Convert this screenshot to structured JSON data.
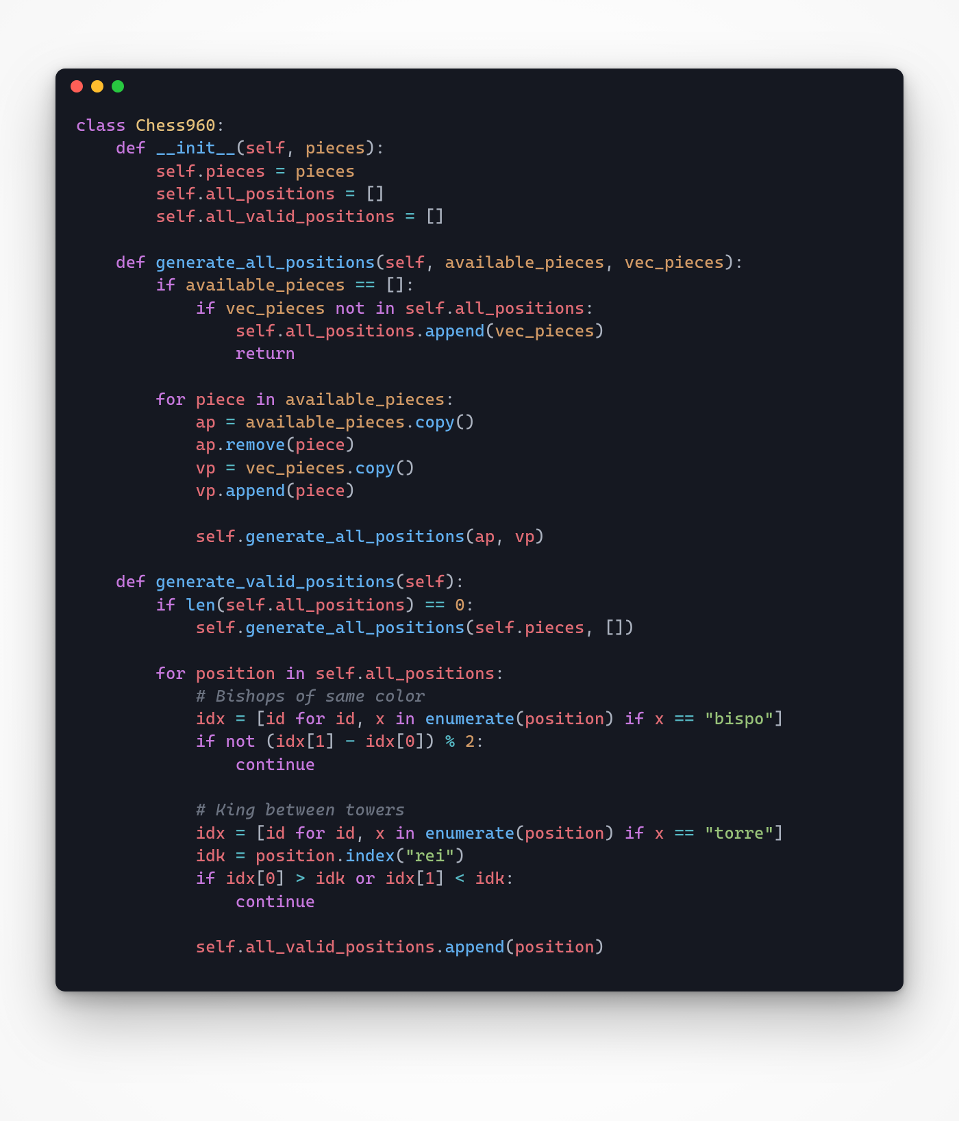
{
  "window": {
    "traffic_lights": [
      "close",
      "minimize",
      "zoom"
    ]
  },
  "code": {
    "language": "python",
    "class_name": "Chess960",
    "methods": {
      "init": {
        "name": "__init__",
        "params": [
          "self",
          "pieces"
        ],
        "body": [
          "self.pieces = pieces",
          "self.all_positions = []",
          "self.all_valid_positions = []"
        ]
      },
      "generate_all_positions": {
        "name": "generate_all_positions",
        "params": [
          "self",
          "available_pieces",
          "vec_pieces"
        ],
        "body": [
          "if available_pieces == []:",
          "    if vec_pieces not in self.all_positions:",
          "        self.all_positions.append(vec_pieces)",
          "        return",
          "",
          "for piece in available_pieces:",
          "    ap = available_pieces.copy()",
          "    ap.remove(piece)",
          "    vp = vec_pieces.copy()",
          "    vp.append(piece)",
          "",
          "    self.generate_all_positions(ap, vp)"
        ]
      },
      "generate_valid_positions": {
        "name": "generate_valid_positions",
        "params": [
          "self"
        ],
        "body": [
          "if len(self.all_positions) == 0:",
          "    self.generate_all_positions(self.pieces, [])",
          "",
          "for position in self.all_positions:",
          "    # Bishops of same color",
          "    idx = [id for id, x in enumerate(position) if x == \"bispo\"]",
          "    if not (idx[1] - idx[0]) % 2:",
          "        continue",
          "",
          "    # King between towers",
          "    idx = [id for id, x in enumerate(position) if x == \"torre\"]",
          "    idk = position.index(\"rei\")",
          "    if idx[0] > idk or idx[1] < idk:",
          "        continue",
          "",
          "    self.all_valid_positions.append(position)"
        ]
      }
    },
    "strings": {
      "bispo": "bispo",
      "torre": "torre",
      "rei": "rei"
    },
    "comments": {
      "bishops": "# Bishops of same color",
      "king": "# King between towers"
    },
    "tokens": {
      "class": "class",
      "def": "def",
      "if": "if",
      "for": "for",
      "in": "in",
      "not": "not",
      "or": "or",
      "return": "return",
      "continue": "continue",
      "self": "self",
      "len": "len",
      "enumerate": "enumerate",
      "append": "append",
      "remove": "remove",
      "copy": "copy",
      "index": "index",
      "pieces_attr": "pieces",
      "all_positions_attr": "all_positions",
      "all_valid_positions_attr": "all_valid_positions",
      "available_pieces": "available_pieces",
      "vec_pieces": "vec_pieces",
      "piece": "piece",
      "position": "position",
      "ap": "ap",
      "vp": "vp",
      "idx": "idx",
      "idk": "idk",
      "id": "id",
      "x": "x",
      "n0": "0",
      "n1": "1",
      "n2": "2"
    }
  }
}
